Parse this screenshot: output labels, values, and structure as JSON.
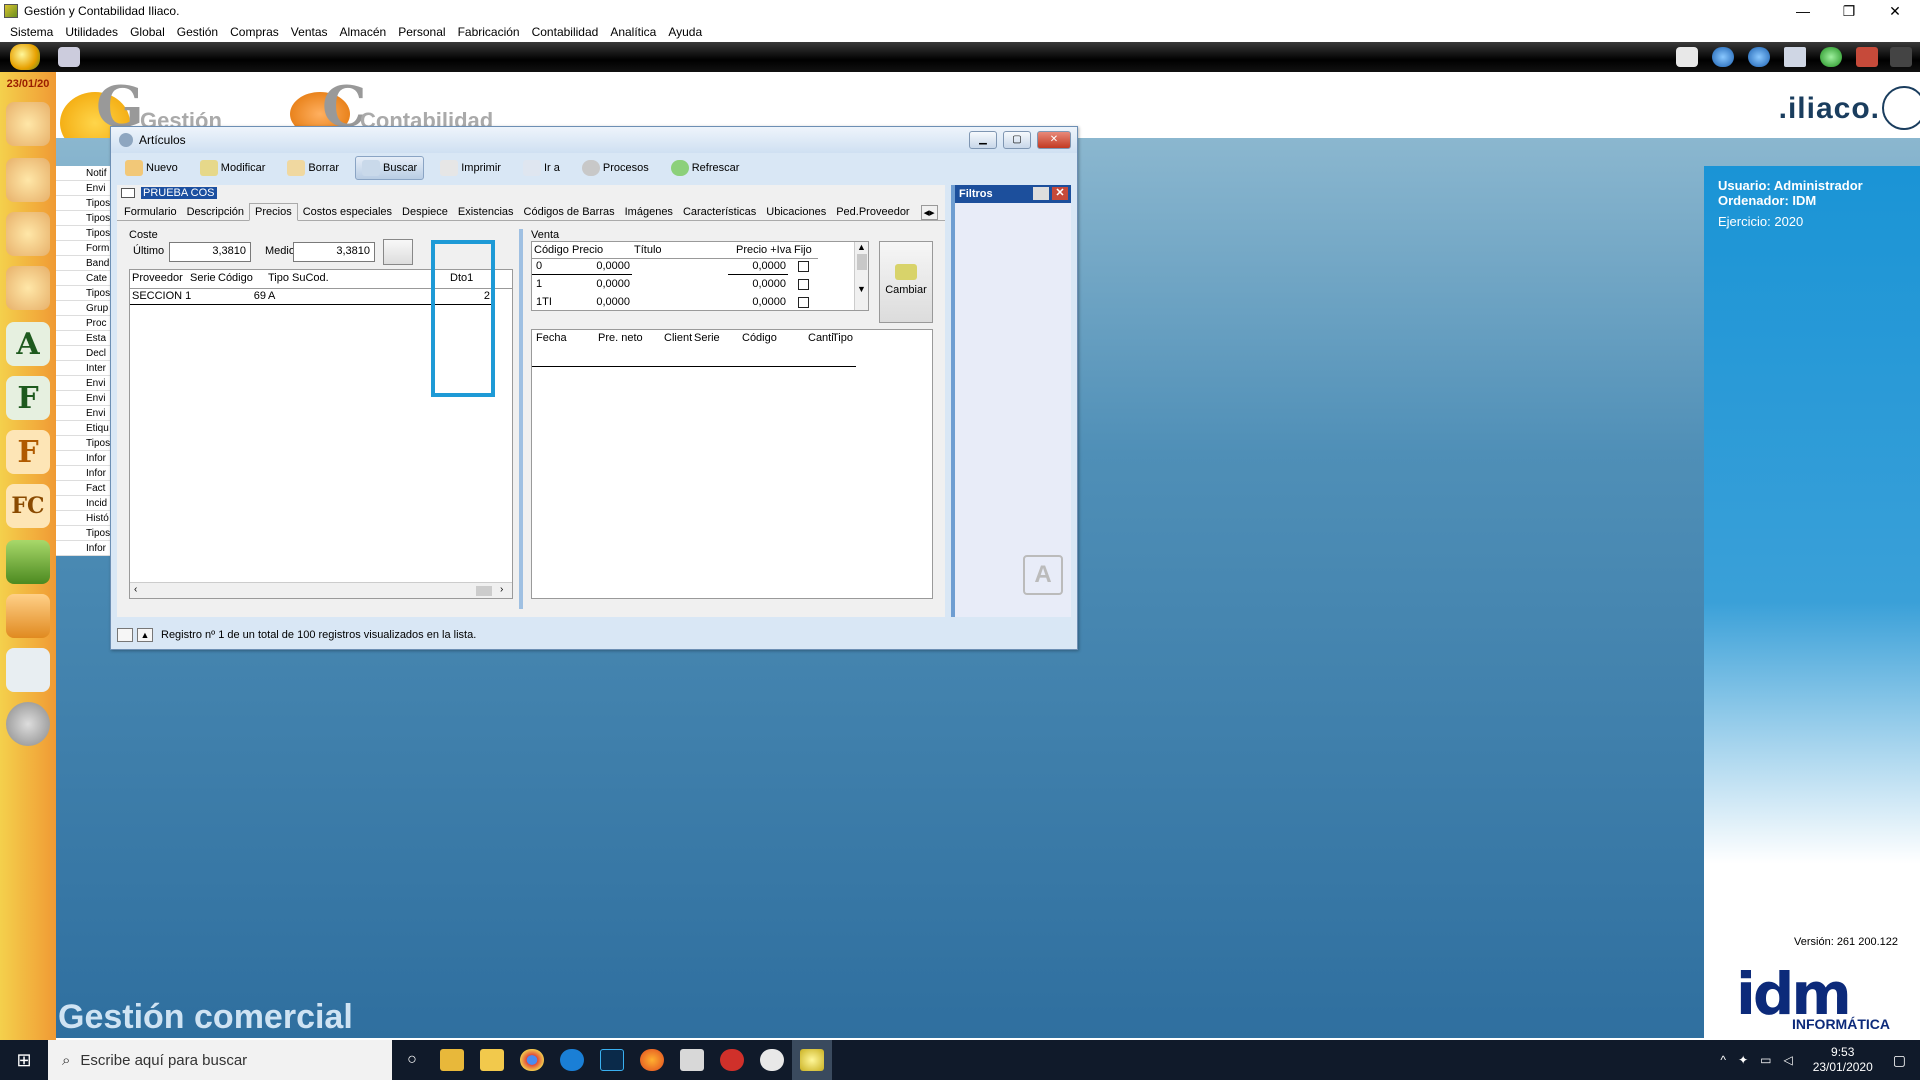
{
  "app": {
    "title": "Gestión y Contabilidad Iliaco.",
    "window_controls": [
      "—",
      "❐",
      "✕"
    ]
  },
  "menu": [
    "Sistema",
    "Utilidades",
    "Global",
    "Gestión",
    "Compras",
    "Ventas",
    "Almacén",
    "Personal",
    "Fabricación",
    "Contabilidad",
    "Analítica",
    "Ayuda"
  ],
  "sidebar": {
    "date": "23/01/20",
    "icons": [
      "users-icon",
      "user-icon",
      "user-p-icon",
      "user-a-icon",
      "letter-a-icon",
      "letter-f-icon",
      "letter-f-orange-icon",
      "letter-fc-icon",
      "bag-green-icon",
      "bag-orange-icon",
      "list-icon",
      "disc-icon"
    ]
  },
  "left_list": [
    "Notif",
    "Envi",
    "Tipos",
    "Tipos",
    "Tipos",
    "Form",
    "Band",
    "Cate",
    "Tipos",
    "Grup",
    "Proc",
    "Esta",
    "Decl",
    "Inter",
    "Envi",
    "Envi",
    "Envi",
    "Etiqu",
    "Tipos",
    "Infor",
    "Infor",
    "Fact",
    "Incid",
    "Histó",
    "Tipos",
    "Infor"
  ],
  "brand": {
    "logo_word1": "Gestión",
    "logo_word2": "Contabilidad",
    "iliaco": ".iliaco.",
    "footer_label": "Gestión comercial"
  },
  "info_panel": {
    "usuario": "Usuario: Administrador",
    "ordenador": "Ordenador: IDM",
    "ejercicio": "Ejercicio: 2020",
    "version": "Versión: 261 200.122",
    "idm": "idm",
    "informatica": "INFORMÁTICA"
  },
  "window": {
    "title": "Artículos",
    "toolbar": [
      "Nuevo",
      "Modificar",
      "Borrar",
      "Buscar",
      "Imprimir",
      "Ir a",
      "Procesos",
      "Refrescar"
    ],
    "record_name": "PRUEBA COS",
    "tabs": [
      "Formulario",
      "Descripción",
      "Precios",
      "Costos especiales",
      "Despiece",
      "Existencias",
      "Códigos de Barras",
      "Imágenes",
      "Características",
      "Ubicaciones",
      "Ped.Proveedor"
    ],
    "active_tab": "Precios",
    "coste": {
      "label": "Coste",
      "ultimo_label": "Último",
      "ultimo_value": "3,3810",
      "medio_label": "Medio",
      "medio_value": "3,3810"
    },
    "proveedores": {
      "headers": [
        "Proveedor",
        "Serie",
        "Código",
        "Tipo",
        "SuCod.",
        "Dto1"
      ],
      "rows": [
        {
          "proveedor": "SECCION 1",
          "serie": "",
          "codigo": "69",
          "tipo": "A",
          "sucod": "",
          "dto1": "2"
        }
      ]
    },
    "venta": {
      "label": "Venta",
      "headers": [
        "Código",
        "Precio",
        "Título",
        "Precio +Iva",
        "Fijo"
      ],
      "rows": [
        {
          "codigo": "0",
          "precio": "0,0000",
          "titulo": "",
          "precio_iva": "0,0000"
        },
        {
          "codigo": "1",
          "precio": "0,0000",
          "titulo": "",
          "precio_iva": "0,0000"
        },
        {
          "codigo": "1TI",
          "precio": "0,0000",
          "titulo": "",
          "precio_iva": "0,0000"
        }
      ],
      "cambiar": "Cambiar"
    },
    "historial": {
      "headers": [
        "Fecha",
        "Pre. neto",
        "Client",
        "Serie",
        "Código",
        "Canti",
        "Tipo"
      ]
    },
    "filtros": "Filtros",
    "status": "Registro nº 1 de un total de 100 registros visualizados en la lista."
  },
  "taskbar": {
    "search_placeholder": "Escribe aquí para buscar",
    "time": "9:53",
    "date": "23/01/2020"
  }
}
